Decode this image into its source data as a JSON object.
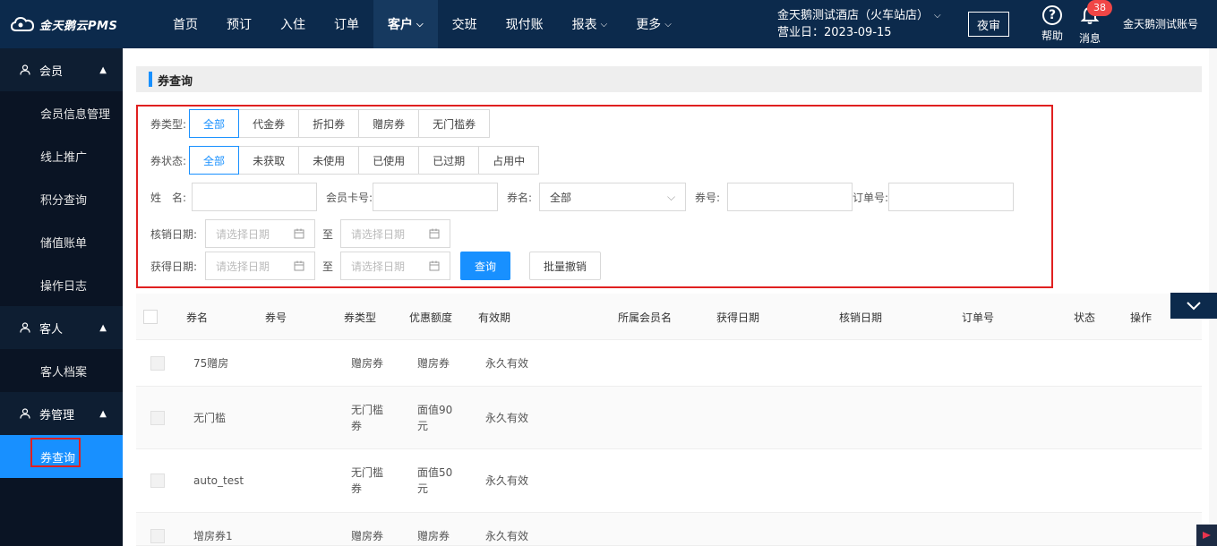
{
  "app": {
    "logo_text": "金天鹅云PMS"
  },
  "nav": [
    {
      "label": "首页",
      "active": false,
      "dropdown": false
    },
    {
      "label": "预订",
      "active": false,
      "dropdown": false
    },
    {
      "label": "入住",
      "active": false,
      "dropdown": false
    },
    {
      "label": "订单",
      "active": false,
      "dropdown": false
    },
    {
      "label": "客户",
      "active": true,
      "dropdown": true
    },
    {
      "label": "交班",
      "active": false,
      "dropdown": false
    },
    {
      "label": "现付账",
      "active": false,
      "dropdown": false
    },
    {
      "label": "报表",
      "active": false,
      "dropdown": true
    },
    {
      "label": "更多",
      "active": false,
      "dropdown": true
    }
  ],
  "header": {
    "hotel_name": "金天鹅测试酒店（火车站店）",
    "business_day": "营业日：2023-09-15",
    "night_audit": "夜审",
    "help_label": "帮助",
    "msg_label": "消息",
    "msg_count": "38",
    "account": "金天鹅测试账号"
  },
  "sidebar": {
    "groups": [
      {
        "label": "会员",
        "items": [
          "会员信息管理",
          "线上推广",
          "积分查询",
          "储值账单",
          "操作日志"
        ]
      },
      {
        "label": "客人",
        "items": [
          "客人档案"
        ]
      },
      {
        "label": "券管理",
        "items": [
          "券查询"
        ]
      }
    ],
    "active_item": "券查询"
  },
  "page": {
    "title": "券查询"
  },
  "filters": {
    "type_label": "券类型:",
    "types": [
      "全部",
      "代金券",
      "折扣券",
      "赠房券",
      "无门槛券"
    ],
    "status_label": "券状态:",
    "statuses": [
      "全部",
      "未获取",
      "未使用",
      "已使用",
      "已过期",
      "占用中"
    ],
    "name_label": "姓　名:",
    "card_label": "会员卡号:",
    "coupon_name_label": "券名:",
    "coupon_name_value": "全部",
    "coupon_no_label": "券号:",
    "order_no_label": "订单号:",
    "verify_date_label": "核销日期:",
    "obtain_date_label": "获得日期:",
    "date_placeholder": "请选择日期",
    "to": "至",
    "search_btn": "查询",
    "batch_btn": "批量撤销"
  },
  "table": {
    "headers": [
      "券名",
      "券号",
      "券类型",
      "优惠额度",
      "有效期",
      "所属会员名",
      "获得日期",
      "核销日期",
      "订单号",
      "状态",
      "操作"
    ],
    "rows": [
      {
        "name": "75赠房",
        "no": "",
        "type": "赠房券",
        "amount": "赠房券",
        "validity": "永久有效"
      },
      {
        "name": "无门槛",
        "no": "",
        "type": "无门槛券",
        "amount": "面值90元",
        "validity": "永久有效"
      },
      {
        "name": "auto_test",
        "no": "",
        "type": "无门槛券",
        "amount": "面值50元",
        "validity": "永久有效"
      },
      {
        "name": "增房券1",
        "no": "",
        "type": "赠房券",
        "amount": "赠房券",
        "validity": "永久有效"
      }
    ]
  },
  "icons": {
    "logo": "cloud-logo-icon",
    "help": "question-circle-icon",
    "msg": "bell-icon",
    "member": "user-icon",
    "calendar": "calendar-icon",
    "collapse": "chevron-down-icon"
  },
  "colors": {
    "topbar": "#0c2a4c",
    "sidebar": "#0e1e32",
    "accent": "#1890ff",
    "highlight": "#e02020",
    "badge": "#f04646"
  }
}
